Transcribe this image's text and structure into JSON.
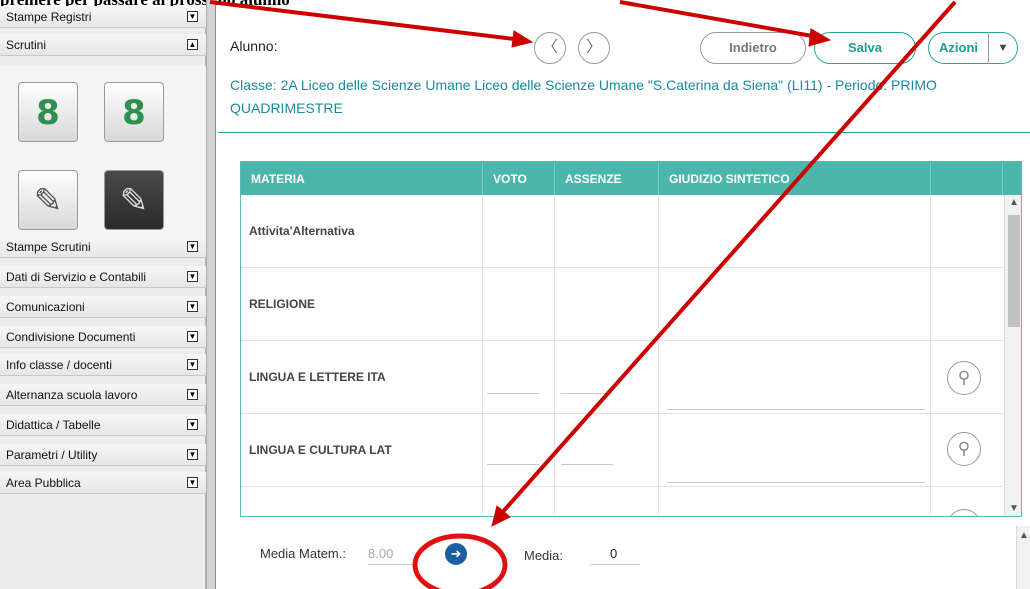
{
  "sidebar": {
    "items_top": [
      {
        "label": "Stampe Registri",
        "toggle": "▼"
      },
      {
        "label": "Scrutini",
        "toggle": "▲"
      }
    ],
    "tiles": [
      {
        "icon": "scrutini-grid-8-icon",
        "glyph": "8"
      },
      {
        "icon": "scrutini-refresh-8-icon",
        "glyph": "8"
      },
      {
        "icon": "notepad-pencil-icon",
        "glyph": "✎"
      },
      {
        "icon": "blackboard-pencil-icon",
        "glyph": "✎"
      }
    ],
    "items": [
      {
        "label": "Stampe Scrutini",
        "toggle": "▼"
      },
      {
        "label": "Dati di Servizio e Contabili",
        "toggle": "▼"
      },
      {
        "label": "Comunicazioni",
        "toggle": "▼"
      },
      {
        "label": "Condivisione Documenti",
        "toggle": "▼"
      },
      {
        "label": "Info classe / docenti",
        "toggle": "▼"
      },
      {
        "label": "Alternanza scuola lavoro",
        "toggle": "▼"
      },
      {
        "label": "Didattica / Tabelle",
        "toggle": "▼"
      },
      {
        "label": "Parametri / Utility",
        "toggle": "▼"
      },
      {
        "label": "Area Pubblica",
        "toggle": "▼"
      }
    ]
  },
  "header": {
    "alunno_label": "Alunno:",
    "prev_icon": "chevron-left-icon",
    "prev_glyph": "〈",
    "next_icon": "chevron-right-icon",
    "next_glyph": "〉",
    "indietro_label": "Indietro",
    "salva_label": "Salva",
    "azioni_label": "Azioni",
    "caret_glyph": "▼",
    "classe_text": "Classe: 2A Liceo delle Scienze Umane Liceo delle Scienze Umane \"S.Caterina da Siena\" (LI11) - Periodo: PRIMO QUADRIMESTRE"
  },
  "table": {
    "columns": [
      "MATERIA",
      "VOTO",
      "ASSENZE",
      "GIUDIZIO SINTETICO",
      ""
    ],
    "rows": [
      {
        "materia": "Attivita'Alternativa",
        "has_inputs": false
      },
      {
        "materia": "RELIGIONE",
        "has_inputs": false
      },
      {
        "materia": "LINGUA E LETTERE ITA",
        "has_inputs": true
      },
      {
        "materia": "LINGUA E CULTURA LAT",
        "has_inputs": true
      },
      {
        "materia": "",
        "has_inputs": true
      }
    ],
    "lens_icon": "magnifier-icon",
    "lens_glyph": "⚲"
  },
  "footer": {
    "media_matem_label": "Media Matem.:",
    "media_matem_value": "8.00",
    "go_icon": "arrow-right-icon",
    "go_glyph": "➜",
    "media_label": "Media:",
    "media_value": "0"
  },
  "colors": {
    "accent": "#4db6ac",
    "header_text": "#1a8a9e",
    "annotation": "#cc0000",
    "go_button": "#1b5fa0"
  }
}
